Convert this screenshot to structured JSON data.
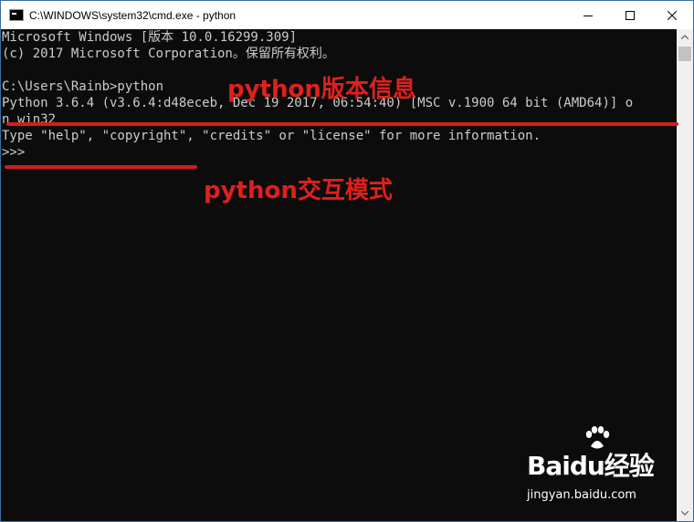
{
  "window": {
    "title": "C:\\WINDOWS\\system32\\cmd.exe - python"
  },
  "console": {
    "lines": [
      "Microsoft Windows [版本 10.0.16299.309]",
      "(c) 2017 Microsoft Corporation。保留所有权利。",
      "",
      "C:\\Users\\Rainb>python",
      "Python 3.6.4 (v3.6.4:d48eceb, Dec 19 2017, 06:54:40) [MSC v.1900 64 bit (AMD64)] o",
      "n win32",
      "Type \"help\", \"copyright\", \"credits\" or \"license\" for more information.",
      ">>>"
    ]
  },
  "annotations": {
    "version_info": "python版本信息",
    "interactive_mode": "python交互模式"
  },
  "watermark": {
    "logo": "Baidu经验",
    "url": "jingyan.baidu.com"
  },
  "colors": {
    "console_bg": "#0c0c0c",
    "console_text": "#cccccc",
    "annotation_red": "#e0201c"
  },
  "icons": {
    "app": "cmd-icon",
    "minimize": "minimize-icon",
    "maximize": "maximize-icon",
    "close": "close-icon"
  }
}
